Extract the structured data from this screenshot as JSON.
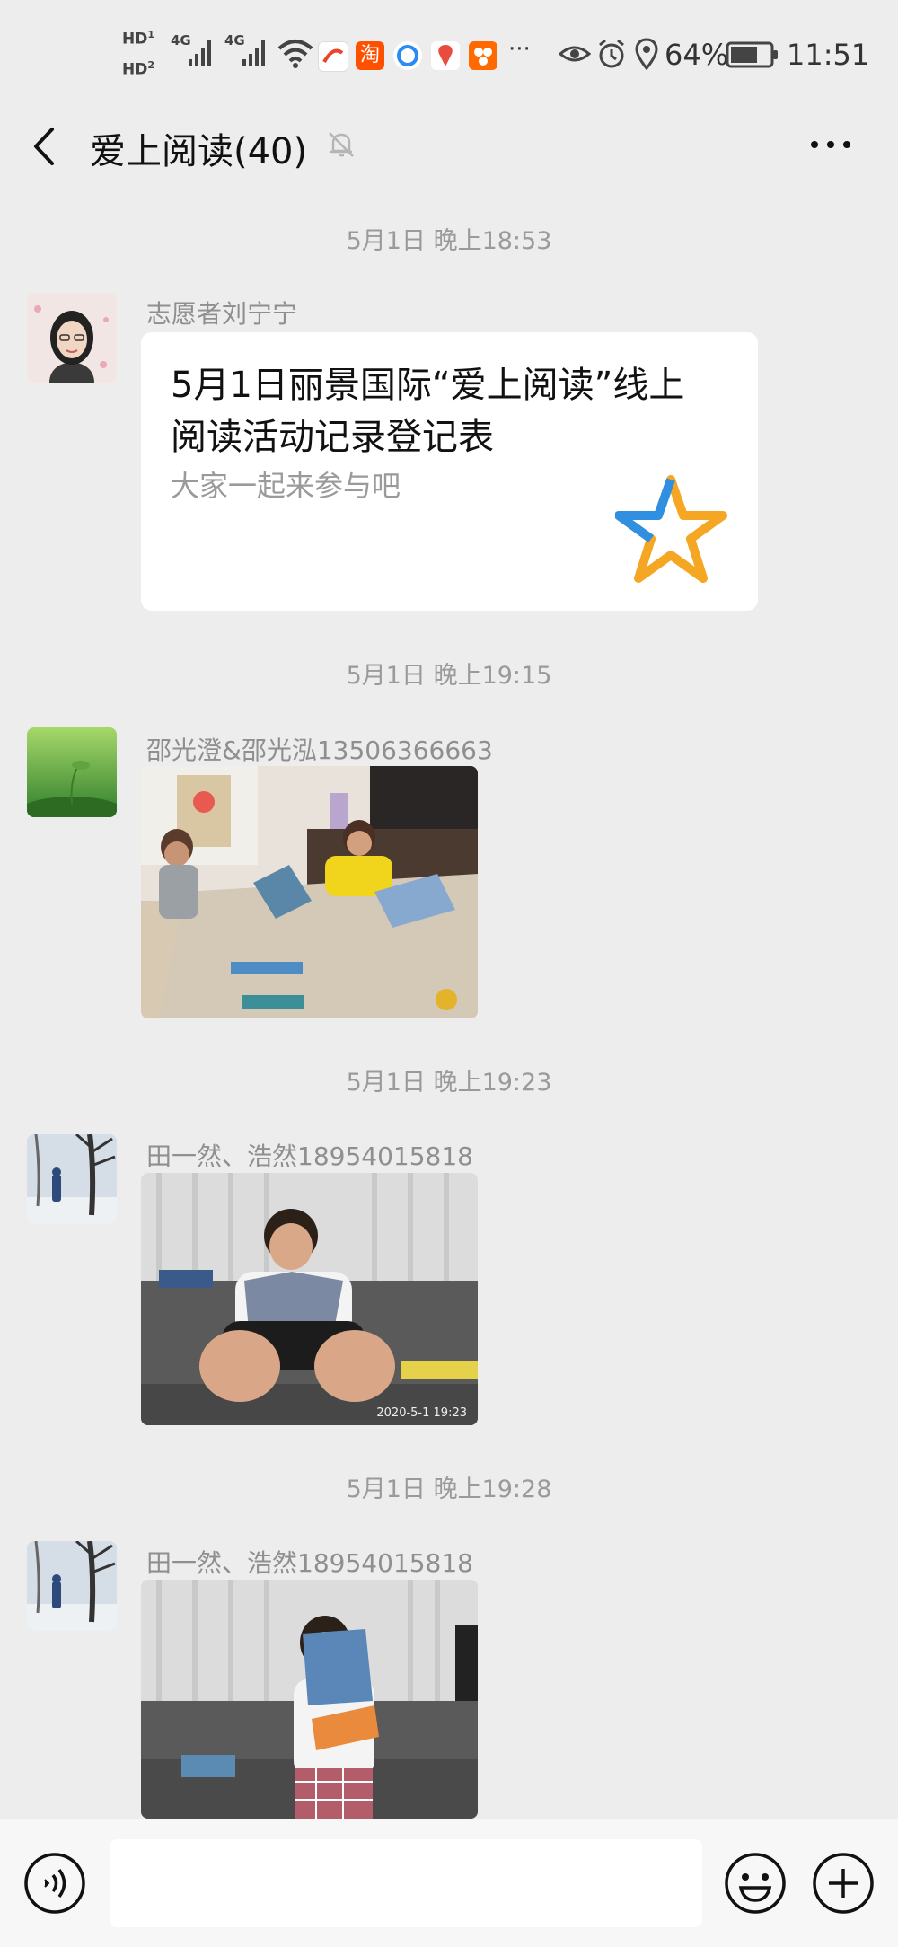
{
  "status_bar": {
    "hd1": "HD",
    "hd2": "HD",
    "sim1_tag": "4G",
    "sim2_tag": "4G",
    "app_taobao": "淘",
    "overflow": "···",
    "battery_percent": "64%",
    "time": "11:51"
  },
  "header": {
    "title": "爱上阅读(40)"
  },
  "messages": [
    {
      "timestamp": "5月1日 晚上18:53",
      "sender": "志愿者刘宁宁",
      "card_title": "5月1日丽景国际“爱上阅读”线上阅读活动记录登记表",
      "card_desc": "大家一起来参与吧"
    },
    {
      "timestamp": "5月1日 晚上19:15",
      "sender": "邵光澄&邵光泓13506366663"
    },
    {
      "timestamp": "5月1日 晚上19:23",
      "sender": "田一然、浩然18954015818",
      "photo_stamp": "2020-5-1 19:23"
    },
    {
      "timestamp": "5月1日 晚上19:28",
      "sender": "田一然、浩然18954015818"
    }
  ],
  "colors": {
    "background": "#ededed",
    "bubble": "#ffffff",
    "timestamp_text": "#9a9a9a",
    "star_blue": "#2f8fe0",
    "star_orange": "#f5a623"
  }
}
